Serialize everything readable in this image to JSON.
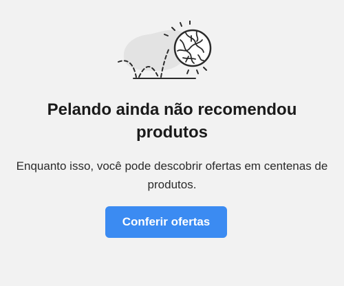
{
  "empty_state": {
    "illustration_icon": "bouncing-ball-icon",
    "title": "Pelando ainda não recomendou produtos",
    "subtitle": "Enquanto isso, você pode descobrir ofertas em centenas de produtos.",
    "cta_label": "Conferir ofertas"
  },
  "colors": {
    "background": "#f2f2f2",
    "accent": "#3b8bf2",
    "text": "#1a1a1a"
  }
}
